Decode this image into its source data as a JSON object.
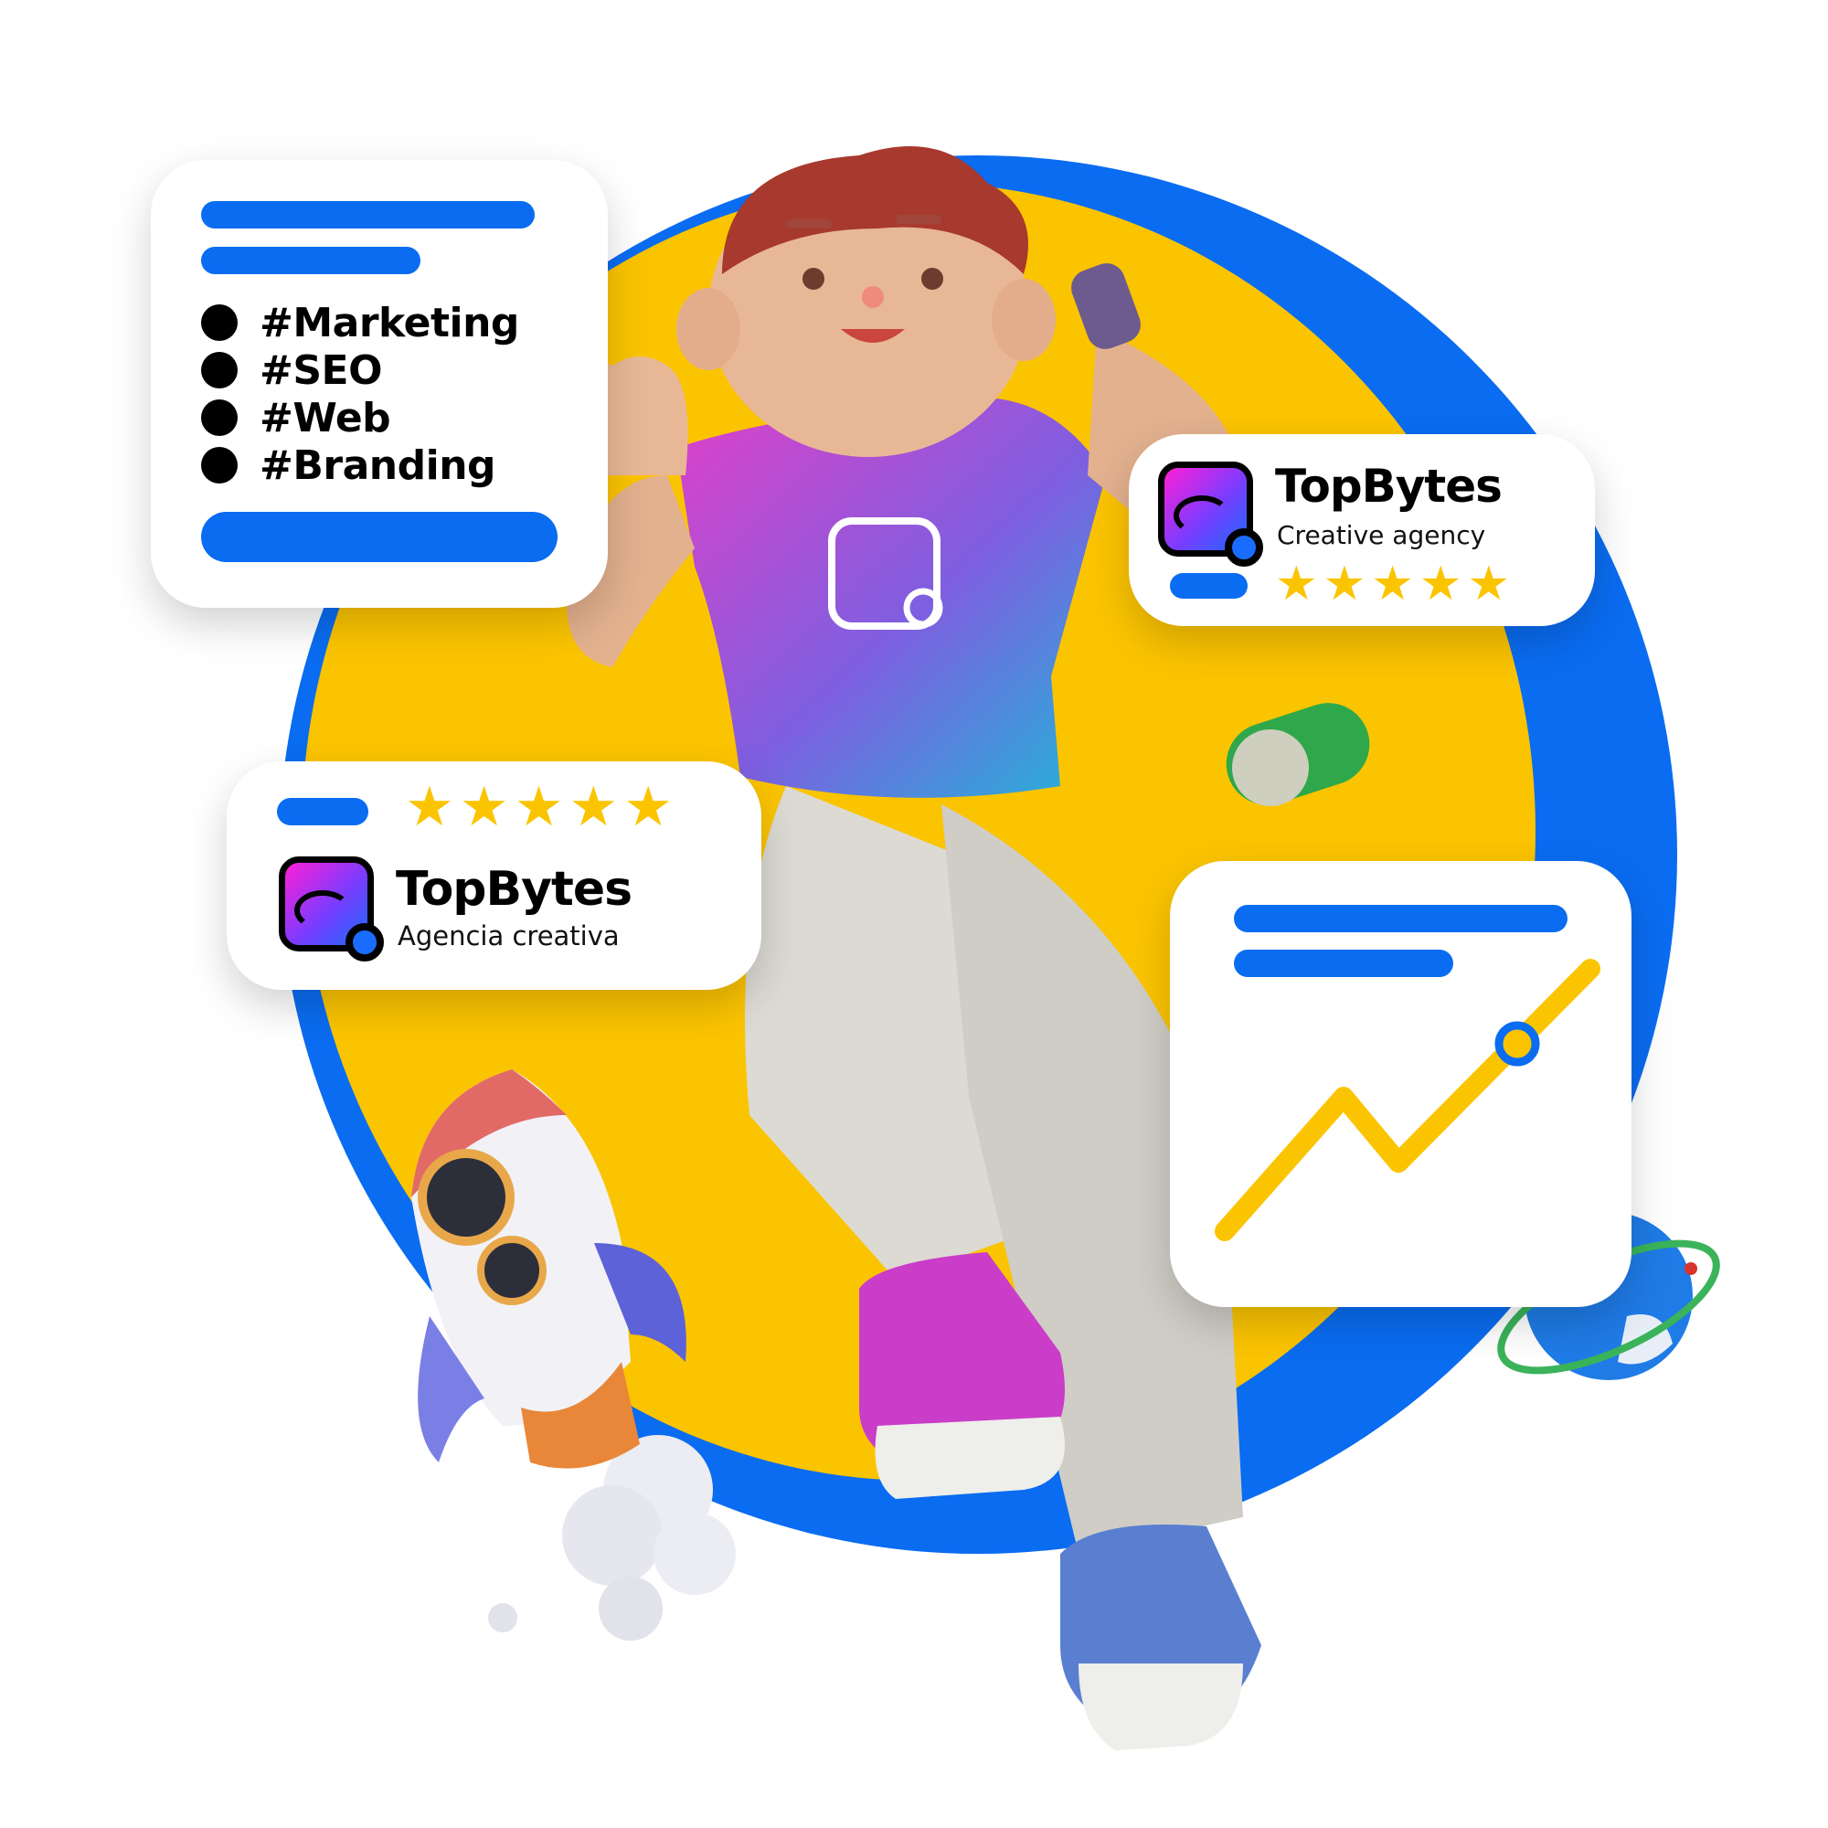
{
  "tags_card": {
    "tags": [
      "#Marketing",
      "#SEO",
      "#Web",
      "#Branding"
    ]
  },
  "brand_card_en": {
    "name": "TopBytes",
    "tagline": "Creative agency",
    "rating": 5
  },
  "brand_card_es": {
    "name": "TopBytes",
    "tagline": "Agencia creativa",
    "rating": 5
  },
  "chart_card": {
    "trend": "rising"
  },
  "colors": {
    "blue": "#0a6cf1",
    "yellow": "#fbc400",
    "magenta": "#e040c8",
    "white": "#ffffff",
    "black": "#000000"
  },
  "icons": [
    "rocket-icon",
    "globe-icon",
    "toggle-switch-icon",
    "star-icon",
    "topbytes-logo-icon"
  ]
}
